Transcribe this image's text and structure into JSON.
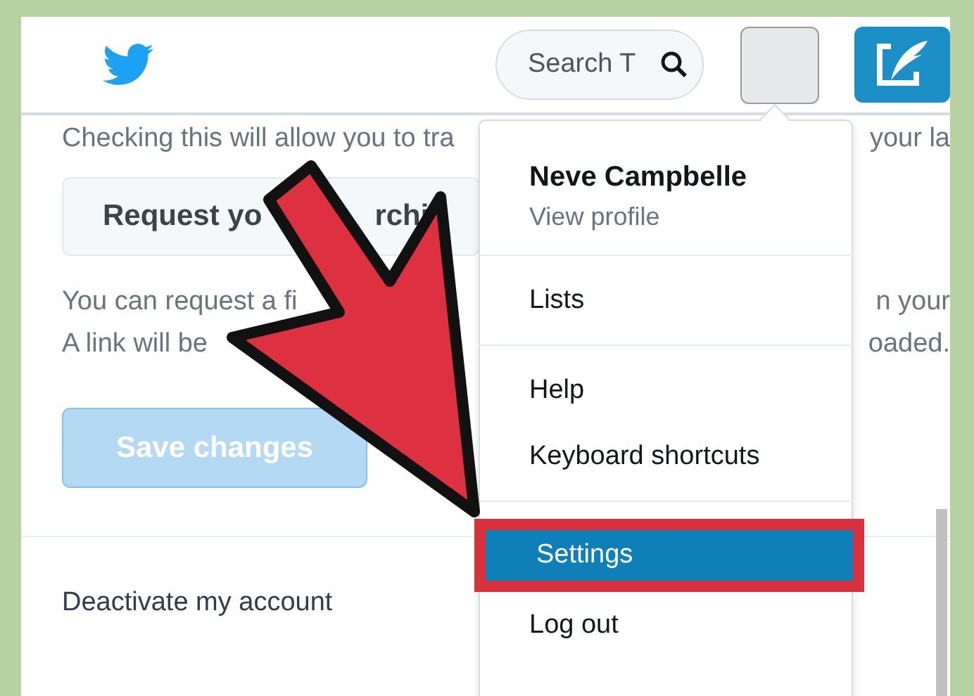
{
  "header": {
    "search": {
      "placeholder": "Search T"
    }
  },
  "content": {
    "notice": [
      "Checking this will allow you to tra",
      "your la"
    ],
    "archive_button": [
      "Request yo",
      "rchi"
    ],
    "paragraph_lines": [
      [
        "You can request a fi",
        "n your"
      ],
      [
        "A link will be",
        "oaded."
      ]
    ],
    "save_button": {
      "label": "Save changes",
      "disabled": true
    },
    "deactivate_link": "Deactivate my account"
  },
  "menu": {
    "name": "Neve Campbelle",
    "profile_link": "View profile",
    "groups": [
      [
        {
          "label": "Lists",
          "selected": false,
          "highlighted": false
        }
      ],
      [
        {
          "label": "Help",
          "selected": false,
          "highlighted": false
        },
        {
          "label": "Keyboard shortcuts",
          "selected": false,
          "highlighted": false
        }
      ],
      [
        {
          "label": "Settings",
          "selected": true,
          "highlighted": true
        },
        {
          "label": "Log out",
          "selected": false,
          "highlighted": false
        }
      ]
    ]
  }
}
